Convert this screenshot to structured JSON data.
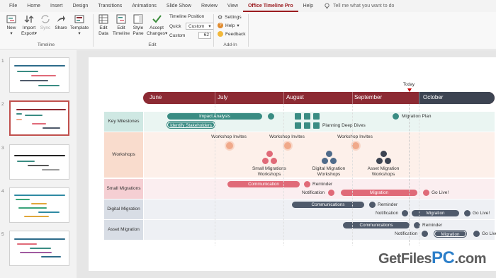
{
  "menu": {
    "tabs": [
      "File",
      "Home",
      "Insert",
      "Design",
      "Transitions",
      "Animations",
      "Slide Show",
      "Review",
      "View",
      "Office Timeline Pro",
      "Help"
    ],
    "active_tab": "Office Timeline Pro",
    "tell_me": "Tell me what you want to do"
  },
  "ribbon": {
    "timeline_group": {
      "label": "Timeline",
      "new": "New",
      "import": "Import",
      "export": "Export",
      "sync": "Sync",
      "share": "Share",
      "template": "Template"
    },
    "edit_group": {
      "label": "Edit",
      "edit_data": "Edit Data",
      "edit_timeline": "Edit Timeline",
      "style_pane": "Style Pane",
      "accept_changes": "Accept Changes",
      "timeline_position": "Timeline Position",
      "quick": "Quick",
      "quick_value": "Custom",
      "custom": "Custom",
      "custom_value": "62"
    },
    "addin_group": {
      "label": "Add-In",
      "settings": "Settings",
      "help": "Help",
      "feedback": "Feedback"
    }
  },
  "thumbnails": {
    "count": 5,
    "selected": 2
  },
  "timeline": {
    "months": [
      "June",
      "July",
      "August",
      "September",
      "October"
    ],
    "today_label": "Today",
    "swimlanes": [
      {
        "name": "Key Milestones",
        "color": "#cfe8e3",
        "tasks": [
          "Impact Analysis",
          "Identify Stakeholders"
        ],
        "milestones": [
          "Planning Deep Dives",
          "Migration Plan"
        ]
      },
      {
        "name": "Workshops",
        "color": "#f9dccd",
        "milestones": [
          "Workshop Invites",
          "Workshop Invites",
          "Workshop Invites"
        ],
        "events": [
          "Small Migrations Workshops",
          "Digital Migration Workshops",
          "Asset Migration Workshops"
        ]
      },
      {
        "name": "Small Migrations",
        "color": "#f5cfd3",
        "tasks": [
          "Communication",
          "Migration"
        ],
        "milestones": [
          "Reminder",
          "Notification",
          "Go Live!"
        ]
      },
      {
        "name": "Digital Migration",
        "color": "#d8dde5",
        "tasks": [
          "Communications",
          "Migration"
        ],
        "milestones": [
          "Reminder",
          "Notification",
          "Go Live!"
        ]
      },
      {
        "name": "Asset Migration",
        "color": "#d8dde5",
        "tasks": [
          "Communications",
          "Migration"
        ],
        "milestones": [
          "Reminder",
          "Notification",
          "Go Live!"
        ]
      }
    ]
  },
  "colors": {
    "accent": "#9b1c20",
    "timeline_past": "#8c2a33",
    "timeline_future": "#3d4452",
    "teal": "#3a8c83",
    "coral": "#e06a78",
    "slate": "#4f5a6b"
  },
  "watermark": {
    "part1": "GetFiles",
    "part2": "PC",
    "part3": ".com"
  }
}
